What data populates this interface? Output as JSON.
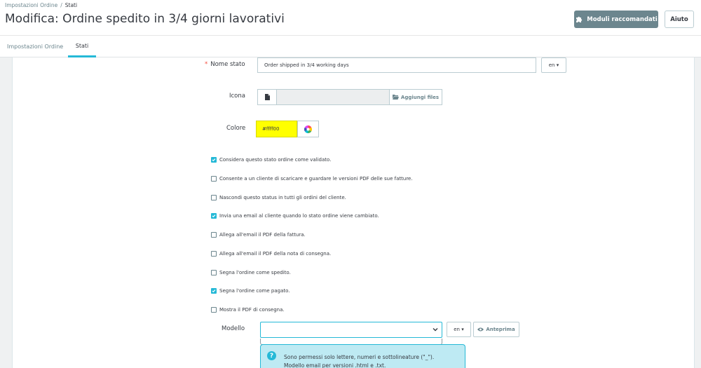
{
  "breadcrumb": {
    "parent": "Impostazioni Ordine",
    "separator": "/",
    "current": "Stati"
  },
  "page": {
    "title": "Modifica: Ordine spedito in 3/4 giorni lavorativi"
  },
  "toolbar": {
    "modules_label": "Moduli raccomandati",
    "help_label": "Aiuto"
  },
  "tabs": [
    {
      "label": "Impostazioni Ordine",
      "active": false
    },
    {
      "label": "Stati",
      "active": true
    }
  ],
  "form": {
    "name": {
      "required_mark": "*",
      "label": "Nome stato",
      "value": "Order shipped in 3/4 working days",
      "lang": "en ▾"
    },
    "icon": {
      "label": "Icona",
      "button_label": "Aggiungi files"
    },
    "color": {
      "label": "Colore",
      "value": "#ffff00"
    },
    "options": [
      {
        "label": "Considera questo stato ordine come validato.",
        "checked": true
      },
      {
        "label": "Consente a un cliente di scaricare e guardare le versioni PDF delle sue fatture.",
        "checked": false
      },
      {
        "label": "Nascondi questo status in tutti gli ordini del cliente.",
        "checked": false
      },
      {
        "label": "Invia una email al cliente quando lo stato ordine viene cambiato.",
        "checked": true
      },
      {
        "label": "Allega all'email il PDF della fattura.",
        "checked": false
      },
      {
        "label": "Allega all'email il PDF della nota di consegna.",
        "checked": false
      },
      {
        "label": "Segna l'ordine come spedito.",
        "checked": false
      },
      {
        "label": "Segna l'ordine come pagato.",
        "checked": true
      },
      {
        "label": "Mostra il PDF di consegna.",
        "checked": false
      }
    ],
    "template": {
      "label": "Modello",
      "value": "",
      "lang": "en ▾",
      "preview_label": "Anteprima",
      "help_line1": "Sono permessi solo lettere, numeri e sottolineature (\"_\").",
      "help_line2": "Modello email per versioni .html e .txt."
    }
  },
  "colors": {
    "accent": "#25b9d7",
    "primary_dark": "#6c868e",
    "required": "#f54c3e",
    "selected_color": "#ffff00",
    "alert_bg": "#beeaf3"
  },
  "icons": [
    "puzzle-icon",
    "file-icon",
    "folder-open-icon",
    "color-wheel-icon",
    "chevron-down-icon",
    "eye-icon",
    "question-icon",
    "check-icon"
  ]
}
